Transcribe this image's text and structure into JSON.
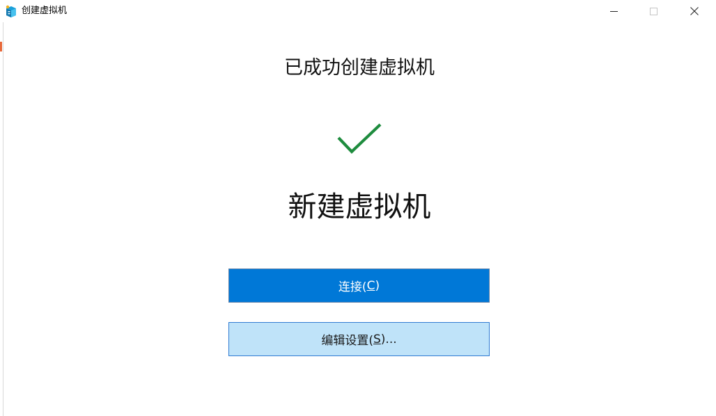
{
  "window": {
    "title": "创建虚拟机",
    "controls": {
      "minimize": "minimize-icon",
      "maximize": "maximize-icon",
      "close": "close-icon"
    }
  },
  "main": {
    "headline": "已成功创建虚拟机",
    "vm_name": "新建虚拟机",
    "status_icon": "checkmark-icon"
  },
  "buttons": {
    "connect": {
      "prefix": "连接(",
      "key": "C",
      "suffix": ")"
    },
    "edit_settings": {
      "prefix": "编辑设置(",
      "key": "S",
      "suffix": ")..."
    }
  },
  "colors": {
    "accent": "#0078d7",
    "secondary_button": "#bfe3f9",
    "success": "#1e8c3e"
  }
}
